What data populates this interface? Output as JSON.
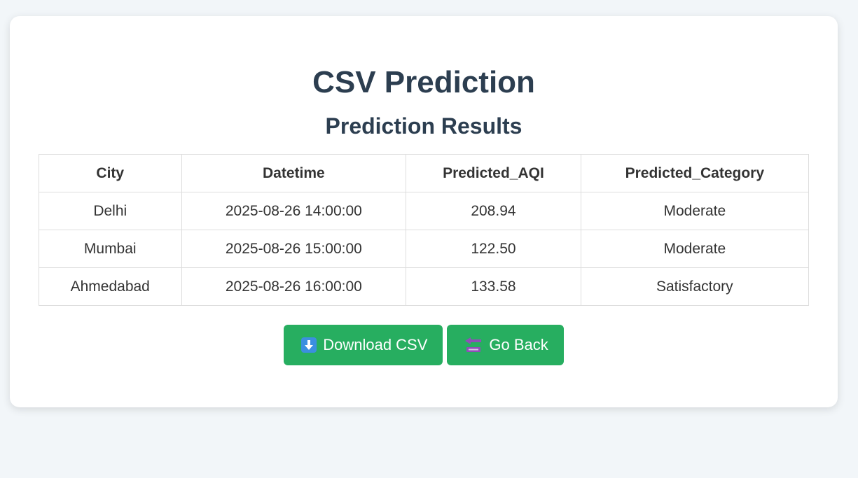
{
  "page": {
    "title": "CSV Prediction",
    "subtitle": "Prediction Results"
  },
  "table": {
    "headers": [
      "City",
      "Datetime",
      "Predicted_AQI",
      "Predicted_Category"
    ],
    "rows": [
      [
        "Delhi",
        "2025-08-26 14:00:00",
        "208.94",
        "Moderate"
      ],
      [
        "Mumbai",
        "2025-08-26 15:00:00",
        "122.50",
        "Moderate"
      ],
      [
        "Ahmedabad",
        "2025-08-26 16:00:00",
        "133.58",
        "Satisfactory"
      ]
    ]
  },
  "actions": {
    "download_label": "Download CSV",
    "download_icon": "down-arrow-icon",
    "back_label": "Go Back",
    "back_icon": "back-arrow-icon"
  },
  "colors": {
    "accent": "#27ae60",
    "heading": "#2c3e50",
    "background": "#f2f6f9"
  }
}
